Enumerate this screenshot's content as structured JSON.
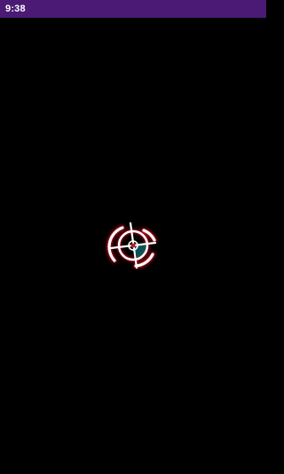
{
  "status_bar": {
    "time": "9:38",
    "background_color": "#4a1a74",
    "text_color": "#ffffff"
  },
  "screen": {
    "background_color": "#000000"
  },
  "loader": {
    "icon": "crosshair-loading-icon",
    "ring_color": "#ffffff",
    "glow_color": "#d01024",
    "segment_color": "#0f5a5e"
  }
}
